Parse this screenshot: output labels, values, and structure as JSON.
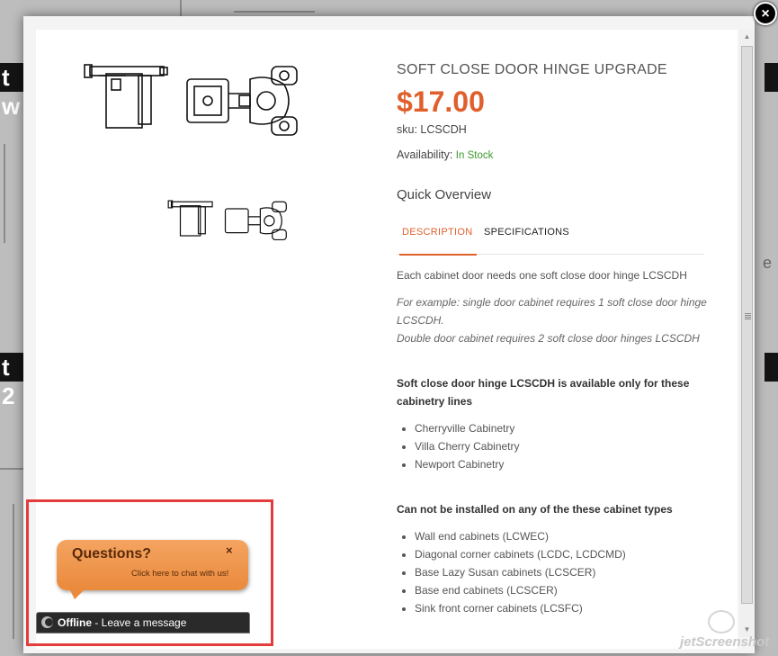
{
  "product": {
    "title": "SOFT CLOSE DOOR HINGE UPGRADE",
    "price": "$17.00",
    "sku_label": "sku:",
    "sku": "LCSCDH",
    "availability_label": "Availability:",
    "availability": "In Stock",
    "overview_heading": "Quick Overview"
  },
  "tabs": [
    {
      "label": "DESCRIPTION",
      "active": true
    },
    {
      "label": "SPECIFICATIONS",
      "active": false
    }
  ],
  "description": {
    "intro": "Each cabinet door needs one soft close door hinge LCSCDH",
    "example_line1": "For example: single door cabinet requires 1 soft close door hinge LCSCDH.",
    "example_line2": "Double door cabinet requires 2 soft close door hinges LCSCDH",
    "available_heading": "Soft close door hinge LCSCDH is available only for these cabinetry lines",
    "available_lines": [
      "Cherryville Cabinetry",
      "Villa Cherry Cabinetry",
      "Newport Cabinetry"
    ],
    "excluded_heading": "Can not be installed on any of the these cabinet types",
    "excluded_types": [
      "Wall end cabinets (LCWEC)",
      "Diagonal corner cabinets (LCDC, LCDCMD)",
      "Base Lazy Susan cabinets (LCSCER)",
      "Base end cabinets (LCSCER)",
      "Sink front corner cabinets (LCSFC)"
    ]
  },
  "chat": {
    "title": "Questions?",
    "subtitle": "Click here to chat with us!",
    "close": "×",
    "status": "Offline",
    "status_message": " - Leave a message"
  },
  "background": {
    "band1_text": "t w",
    "band2_text": "t 2",
    "right_letter": "e"
  },
  "modal": {
    "close": "×"
  },
  "icons": {
    "close": "close-icon",
    "scroll_up": "arrow-up-icon",
    "scroll_down": "arrow-down-icon",
    "chat_status": "chat-status-icon"
  },
  "colors": {
    "accent": "#e0602d",
    "in_stock": "#3a9a2a",
    "chat_orange": "#ea8a3c",
    "highlight": "#e23c3c"
  },
  "watermark": "jetScreenshot"
}
